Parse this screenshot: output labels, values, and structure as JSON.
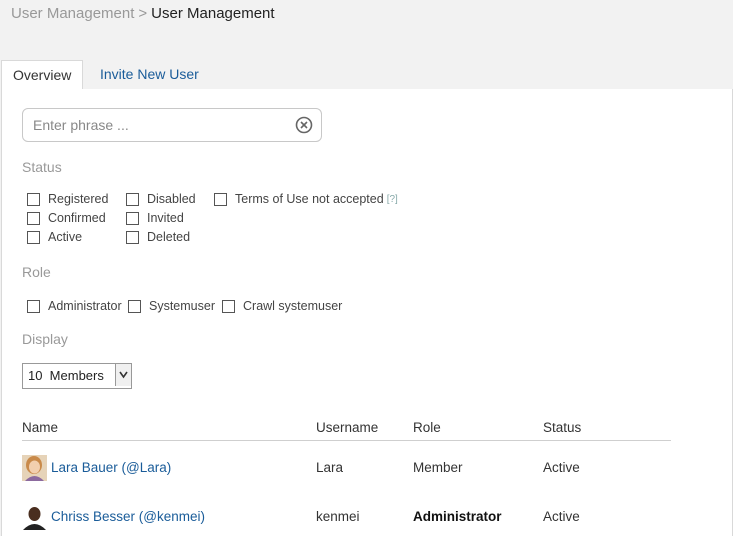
{
  "breadcrumb": {
    "parent": "User Management",
    "separator": ">",
    "current": "User Management"
  },
  "tabs": [
    {
      "label": "Overview",
      "active": true
    },
    {
      "label": "Invite New User",
      "active": false
    }
  ],
  "search": {
    "placeholder": "Enter phrase ...",
    "value": ""
  },
  "status": {
    "label": "Status",
    "options": [
      "Registered",
      "Confirmed",
      "Active",
      "Disabled",
      "Invited",
      "Deleted",
      "Terms of Use not accepted"
    ],
    "terms_hint": "[?]"
  },
  "role": {
    "label": "Role",
    "options": [
      "Administrator",
      "Systemuser",
      "Crawl systemuser"
    ]
  },
  "display": {
    "label": "Display",
    "selected": "10  Members"
  },
  "table": {
    "headers": [
      "Name",
      "Username",
      "Role",
      "Status"
    ],
    "rows": [
      {
        "name": "Lara Bauer (@Lara)",
        "username": "Lara",
        "role": "Member",
        "status": "Active"
      },
      {
        "name": "Chriss Besser (@kenmei)",
        "username": "kenmei",
        "role": "Administrator",
        "status": "Active"
      }
    ]
  }
}
